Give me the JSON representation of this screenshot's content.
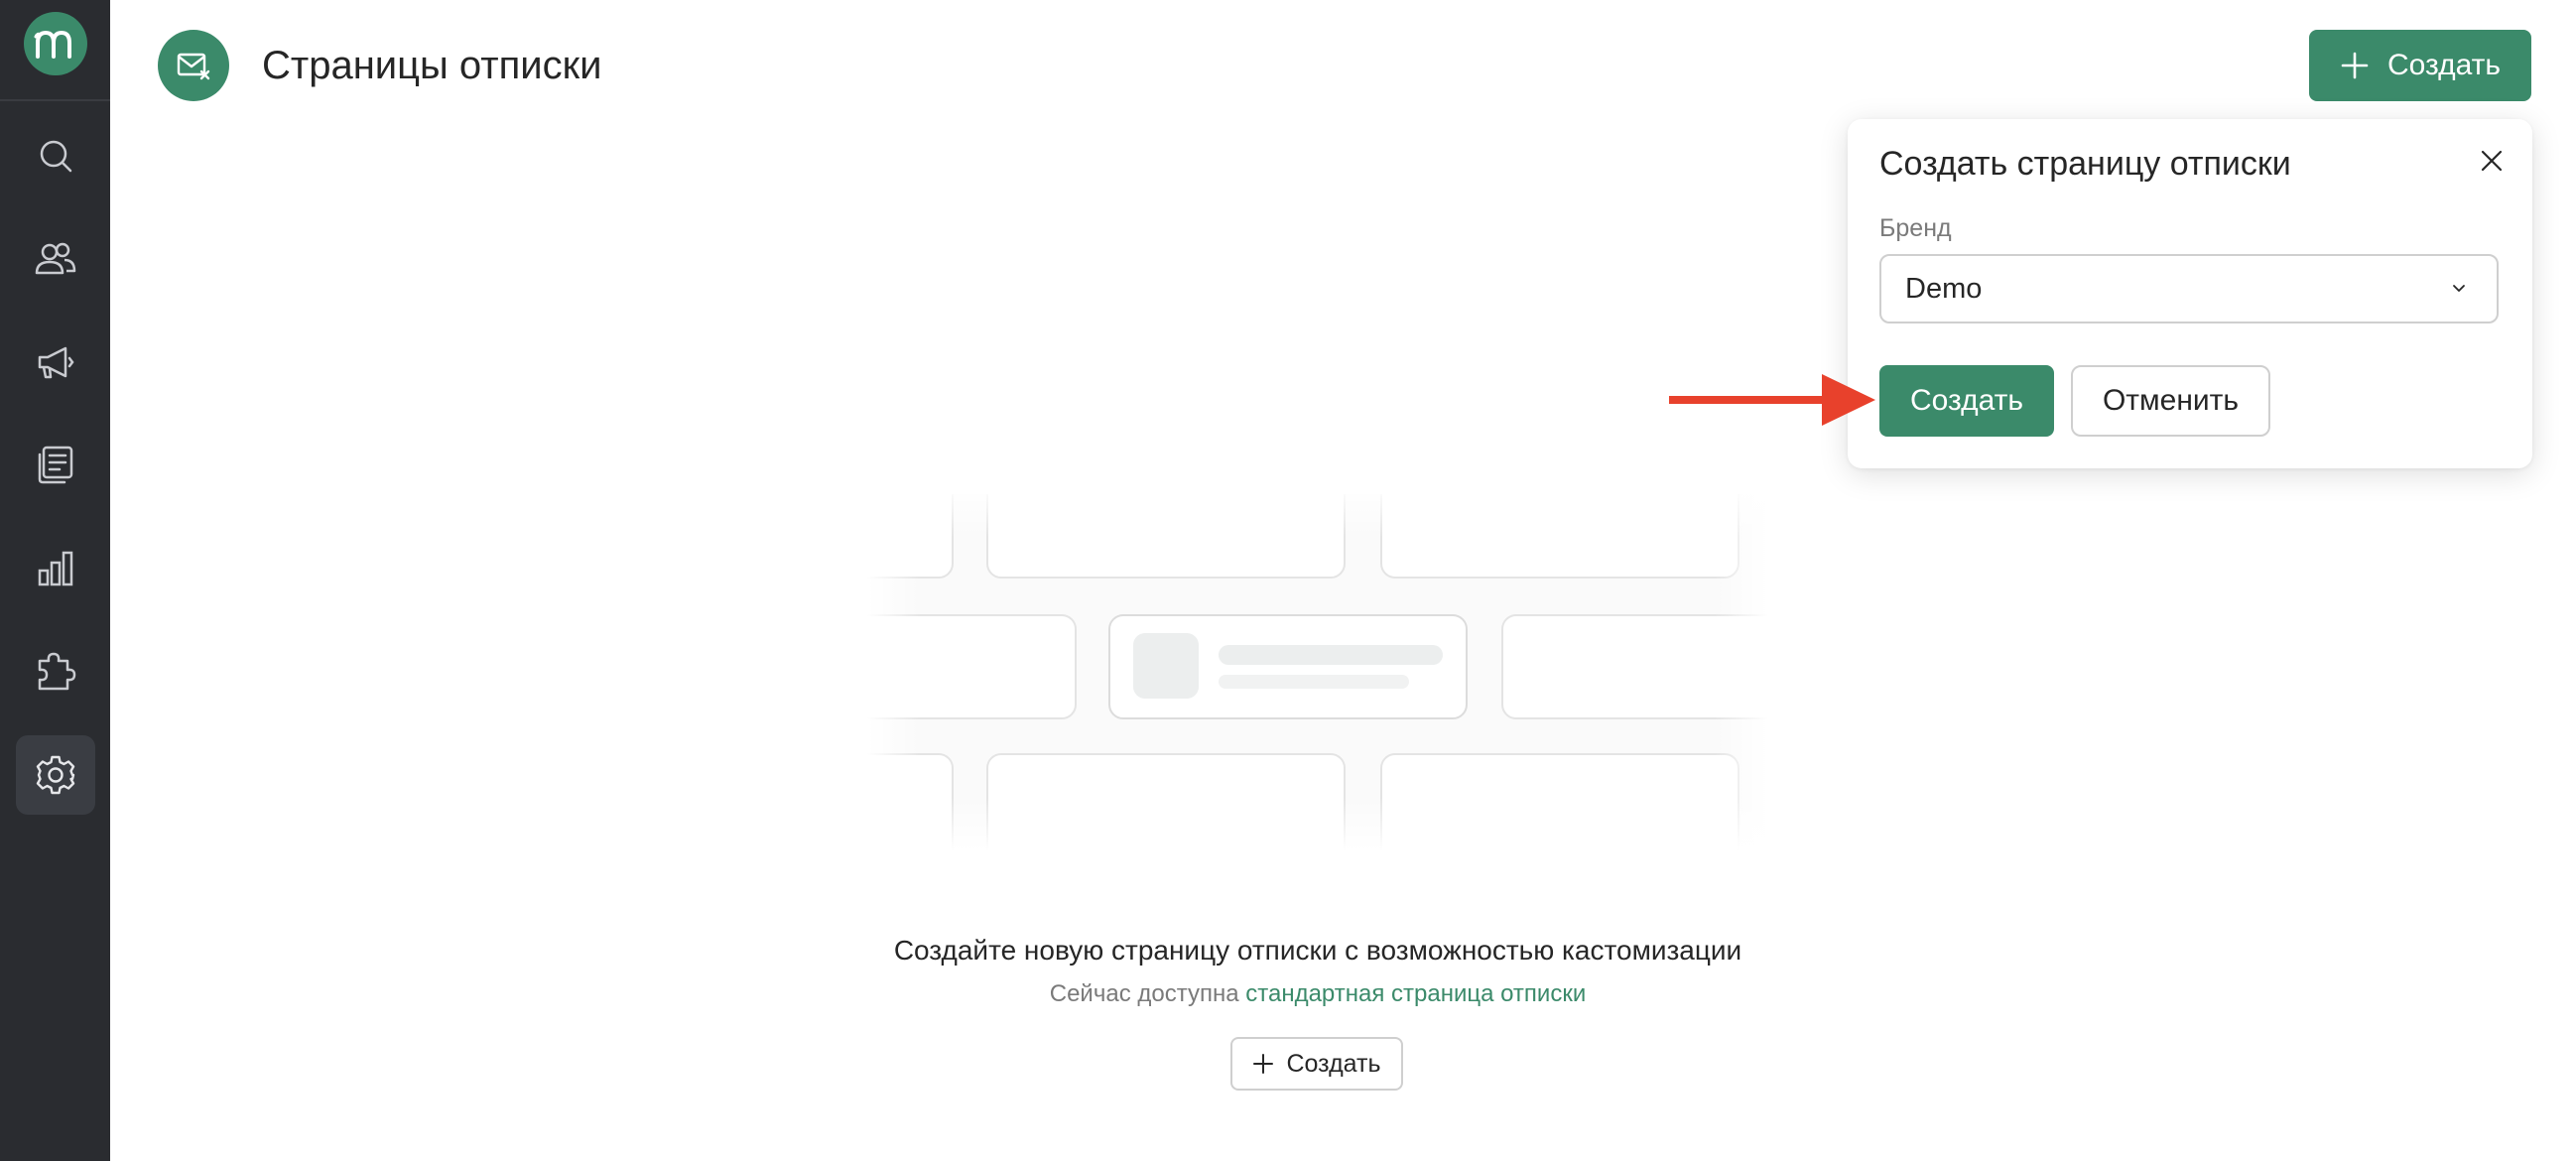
{
  "sidebar": {
    "logo_icon": "brand-m-logo",
    "items": [
      {
        "name": "search",
        "icon": "search-icon",
        "active": false
      },
      {
        "name": "contacts",
        "icon": "users-icon",
        "active": false
      },
      {
        "name": "campaigns",
        "icon": "megaphone-icon",
        "active": false
      },
      {
        "name": "content",
        "icon": "pages-icon",
        "active": false
      },
      {
        "name": "analytics",
        "icon": "bar-chart-icon",
        "active": false
      },
      {
        "name": "integrations",
        "icon": "puzzle-icon",
        "active": false
      },
      {
        "name": "settings",
        "icon": "gear-icon",
        "active": true
      }
    ]
  },
  "header": {
    "icon": "mail-unsubscribe-icon",
    "title": "Страницы отписки",
    "create_label": "Создать"
  },
  "popover": {
    "title": "Создать страницу отписки",
    "brand_label": "Бренд",
    "brand_value": "Demo",
    "create_label": "Создать",
    "cancel_label": "Отменить"
  },
  "empty_state": {
    "title": "Создайте новую страницу отписки с возможностью кастомизации",
    "subtitle_prefix": "Сейчас доступна",
    "subtitle_link": "стандартная страница отписки",
    "create_label": "Создать"
  },
  "colors": {
    "accent": "#3b8a6a",
    "sidebar": "#2a2c30",
    "annotation_arrow": "#e8412c"
  }
}
